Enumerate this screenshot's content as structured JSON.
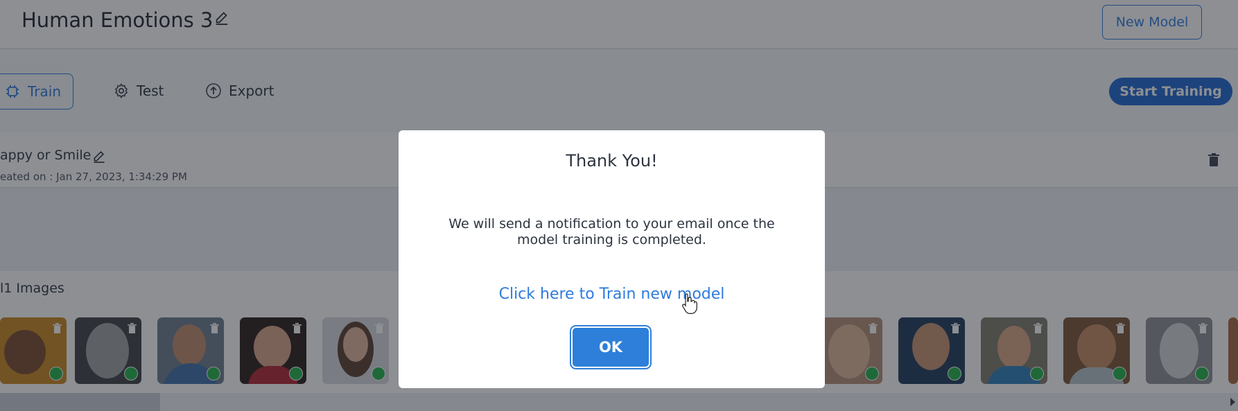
{
  "header": {
    "model_title": "Human Emotions 3",
    "new_model_label": "New Model"
  },
  "tabs": [
    {
      "label": "Train",
      "icon": "cpu-icon"
    },
    {
      "label": "Test",
      "icon": "gear-icon"
    },
    {
      "label": "Export",
      "icon": "upload-icon"
    }
  ],
  "start_training_label": "Start Training",
  "class_card": {
    "name": "appy or Smile",
    "created": "eated on : Jan 27, 2023, 1:34:29 PM"
  },
  "images_label": "l1 Images",
  "modal": {
    "title": "Thank You!",
    "message": "We will send a notification to your email once the model training is completed.",
    "link": "Click here to Train new model",
    "ok_label": "OK"
  },
  "colors": {
    "accent": "#2f7bdc",
    "primary_button": "#1f66d1",
    "success": "#22b34a"
  }
}
